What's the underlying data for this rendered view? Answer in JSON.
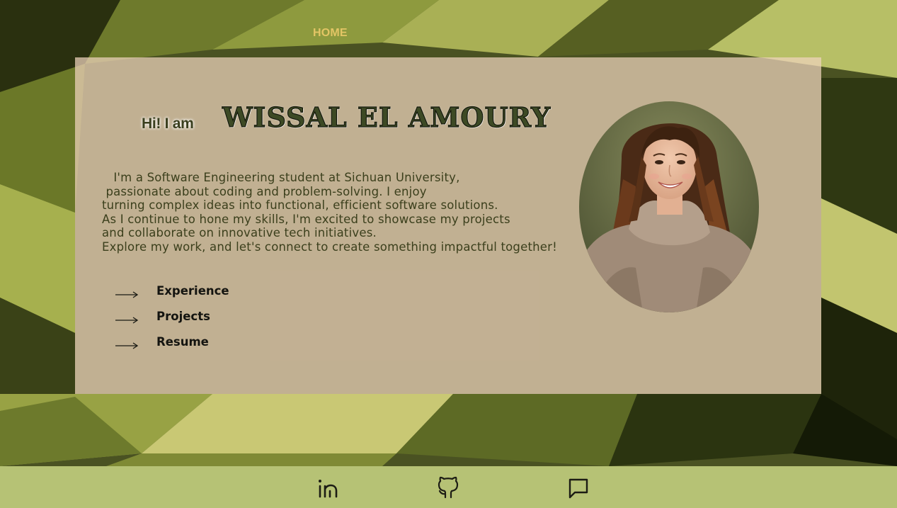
{
  "nav": {
    "home_label": "HOME"
  },
  "hero": {
    "greeting": "Hi! I am",
    "name": "WISSAL  EL AMOURY",
    "bio_lines": [
      "   I'm a Software Engineering student at Sichuan University,",
      " passionate about coding and problem-solving. I enjoy",
      "turning complex ideas into functional, efficient software solutions.",
      "As I continue to hone my skills, I'm excited to showcase my projects",
      "and collaborate on innovative tech initiatives.",
      "Explore my work, and let's connect to create something impactful together!"
    ],
    "links": [
      {
        "label": "Experience",
        "icon": "arrow-right-icon"
      },
      {
        "label": "Projects",
        "icon": "arrow-right-icon"
      },
      {
        "label": "Resume",
        "icon": "arrow-right-icon"
      }
    ],
    "avatar": "profile-photo"
  },
  "footer": {
    "social": [
      {
        "icon": "linkedin-icon"
      },
      {
        "icon": "github-icon"
      },
      {
        "icon": "message-icon"
      }
    ]
  },
  "colors": {
    "accent": "#e3c565",
    "card": "#f0d4be",
    "footer": "#b6c275",
    "text": "#3b3f1c"
  }
}
